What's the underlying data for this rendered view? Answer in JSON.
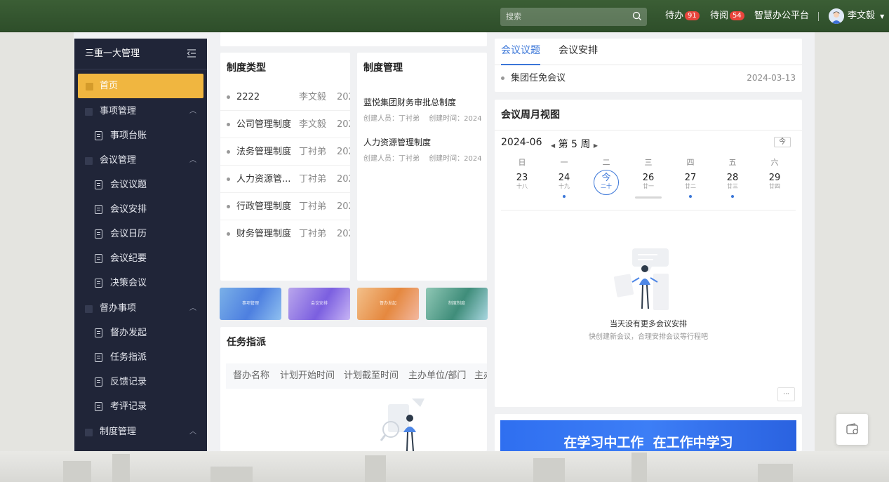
{
  "header": {
    "search_placeholder": "搜索",
    "todo_label": "待办",
    "todo_count": "91",
    "toread_label": "待阅",
    "toread_count": "54",
    "platform": "智慧办公平台",
    "user": "李文毅"
  },
  "sidebar": {
    "title": "三重一大管理",
    "items": [
      {
        "label": "首页"
      },
      {
        "label": "事项管理"
      },
      {
        "label": "事项台账"
      },
      {
        "label": "会议管理"
      },
      {
        "label": "会议议题"
      },
      {
        "label": "会议安排"
      },
      {
        "label": "会议日历"
      },
      {
        "label": "会议纪要"
      },
      {
        "label": "决策会议"
      },
      {
        "label": "督办事项"
      },
      {
        "label": "督办发起"
      },
      {
        "label": "任务指派"
      },
      {
        "label": "反馈记录"
      },
      {
        "label": "考评记录"
      },
      {
        "label": "制度管理"
      }
    ]
  },
  "types_card": {
    "title": "制度类型",
    "rows": [
      {
        "name": "2222",
        "user": "李文毅",
        "date": "202"
      },
      {
        "name": "公司管理制度",
        "user": "李文毅",
        "date": "202"
      },
      {
        "name": "法务管理制度",
        "user": "丁衬弟",
        "date": "202"
      },
      {
        "name": "人力资源管...",
        "user": "丁衬弟",
        "date": "202"
      },
      {
        "name": "行政管理制度",
        "user": "丁衬弟",
        "date": "202"
      },
      {
        "name": "财务管理制度",
        "user": "丁衬弟",
        "date": "202"
      }
    ]
  },
  "rules_card": {
    "title": "制度管理",
    "items": [
      {
        "title": "蓝悦集团财务审批总制度",
        "creator": "创建人员：丁衬弟",
        "created": "创建时间：2024"
      },
      {
        "title": "人力资源管理制度",
        "creator": "创建人员：丁衬弟",
        "created": "创建时间：2024"
      }
    ]
  },
  "banners": [
    "事项管理",
    "会议安排",
    "督办发起",
    "制度制度"
  ],
  "task_card": {
    "title": "任务指派",
    "columns": [
      "督办名称",
      "计划开始时间",
      "计划截至时间",
      "主办单位/部门",
      "主办"
    ]
  },
  "meeting_tabs": {
    "tabs": [
      "会议议题",
      "会议安排"
    ],
    "item": {
      "title": "集团任免会议",
      "date": "2024-03-13"
    }
  },
  "weekview": {
    "title": "会议周月视图",
    "month": "2024-06",
    "week": "第 5 周",
    "today_btn": "今",
    "weekdays": [
      "日",
      "一",
      "二",
      "三",
      "四",
      "五",
      "六"
    ],
    "days": [
      {
        "num": "23",
        "lunar": "十八",
        "has_event": false
      },
      {
        "num": "24",
        "lunar": "十九",
        "has_event": true
      },
      {
        "num": "今",
        "lunar": "二十",
        "has_event": false
      },
      {
        "num": "26",
        "lunar": "廿一",
        "has_event": false
      },
      {
        "num": "27",
        "lunar": "廿二",
        "has_event": true
      },
      {
        "num": "28",
        "lunar": "廿三",
        "has_event": true
      },
      {
        "num": "29",
        "lunar": "廿四",
        "has_event": false
      }
    ],
    "empty_title": "当天没有更多会议安排",
    "empty_sub": "快创建新会议，合理安排会议等行程吧",
    "more": "···"
  },
  "promo": {
    "text": "在学习中工作  在工作中学习"
  },
  "colors": {
    "accent": "#3a76d8",
    "sidebar_bg": "#202538",
    "active": "#f0b640",
    "topbar": "#345630"
  }
}
